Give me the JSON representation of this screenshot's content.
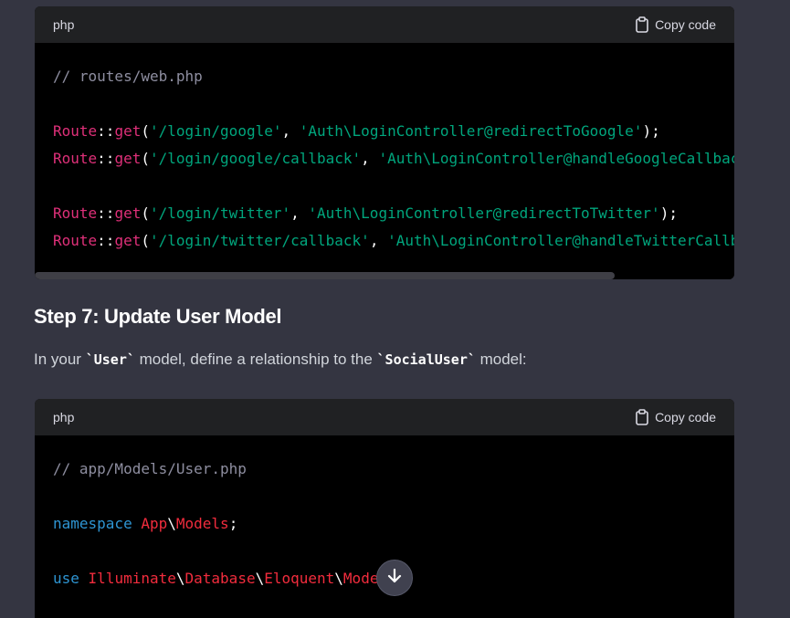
{
  "block1": {
    "lang": "php",
    "copy_label": "Copy code",
    "lines": [
      [
        {
          "t": "// routes/web.php",
          "c": "comment"
        }
      ],
      [],
      [
        {
          "t": "Route",
          "c": "class"
        },
        {
          "t": "::",
          "c": "plain"
        },
        {
          "t": "get",
          "c": "func"
        },
        {
          "t": "(",
          "c": "plain"
        },
        {
          "t": "'/login/google'",
          "c": "str"
        },
        {
          "t": ", ",
          "c": "plain"
        },
        {
          "t": "'Auth\\LoginController@redirectToGoogle'",
          "c": "str"
        },
        {
          "t": ");",
          "c": "plain"
        }
      ],
      [
        {
          "t": "Route",
          "c": "class"
        },
        {
          "t": "::",
          "c": "plain"
        },
        {
          "t": "get",
          "c": "func"
        },
        {
          "t": "(",
          "c": "plain"
        },
        {
          "t": "'/login/google/callback'",
          "c": "str"
        },
        {
          "t": ", ",
          "c": "plain"
        },
        {
          "t": "'Auth\\LoginController@handleGoogleCallback'",
          "c": "str"
        },
        {
          "t": ");",
          "c": "plain"
        }
      ],
      [],
      [
        {
          "t": "Route",
          "c": "class"
        },
        {
          "t": "::",
          "c": "plain"
        },
        {
          "t": "get",
          "c": "func"
        },
        {
          "t": "(",
          "c": "plain"
        },
        {
          "t": "'/login/twitter'",
          "c": "str"
        },
        {
          "t": ", ",
          "c": "plain"
        },
        {
          "t": "'Auth\\LoginController@redirectToTwitter'",
          "c": "str"
        },
        {
          "t": ");",
          "c": "plain"
        }
      ],
      [
        {
          "t": "Route",
          "c": "class"
        },
        {
          "t": "::",
          "c": "plain"
        },
        {
          "t": "get",
          "c": "func"
        },
        {
          "t": "(",
          "c": "plain"
        },
        {
          "t": "'/login/twitter/callback'",
          "c": "str"
        },
        {
          "t": ", ",
          "c": "plain"
        },
        {
          "t": "'Auth\\LoginController@handleTwitterCallback'",
          "c": "str"
        },
        {
          "t": ");",
          "c": "plain"
        }
      ]
    ]
  },
  "heading": "Step 7: Update User Model",
  "paragraph": {
    "before": "In your ",
    "code1": "`User`",
    "middle": " model, define a relationship to the ",
    "code2": "`SocialUser`",
    "after": " model:"
  },
  "block2": {
    "lang": "php",
    "copy_label": "Copy code",
    "lines": [
      [
        {
          "t": "// app/Models/User.php",
          "c": "comment"
        }
      ],
      [],
      [
        {
          "t": "namespace",
          "c": "kw"
        },
        {
          "t": " ",
          "c": "plain"
        },
        {
          "t": "App",
          "c": "ns"
        },
        {
          "t": "\\",
          "c": "plain"
        },
        {
          "t": "Models",
          "c": "ns"
        },
        {
          "t": ";",
          "c": "plain"
        }
      ],
      [],
      [
        {
          "t": "use",
          "c": "kw"
        },
        {
          "t": " ",
          "c": "plain"
        },
        {
          "t": "Illuminate",
          "c": "ns"
        },
        {
          "t": "\\",
          "c": "plain"
        },
        {
          "t": "Database",
          "c": "ns"
        },
        {
          "t": "\\",
          "c": "plain"
        },
        {
          "t": "Eloquent",
          "c": "ns"
        },
        {
          "t": "\\",
          "c": "plain"
        },
        {
          "t": "Model",
          "c": "ns"
        },
        {
          "t": ";",
          "c": "plain"
        }
      ]
    ]
  },
  "icons": {
    "copy": "clipboard-icon",
    "scroll": "arrow-down-icon"
  },
  "colors": {
    "background": "#343541",
    "code_bg": "#000000",
    "header_bg": "#202123",
    "string": "#00a67d",
    "class": "#df3079",
    "keyword": "#2e95d3",
    "namespace": "#f22c3d",
    "comment": "#8e8ea0"
  }
}
